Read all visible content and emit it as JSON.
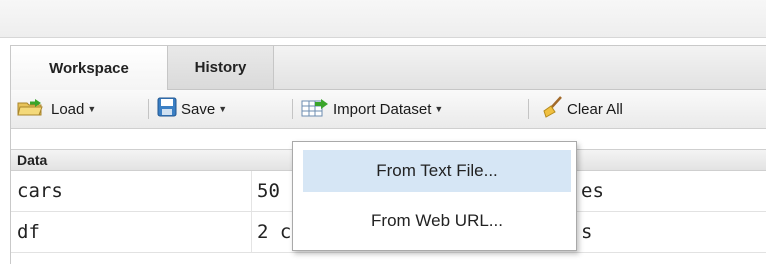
{
  "tabs": [
    {
      "label": "Workspace",
      "active": true
    },
    {
      "label": "History",
      "active": false
    }
  ],
  "toolbar": {
    "load_label": "Load",
    "save_label": "Save",
    "import_label": "Import Dataset",
    "clear_label": "Clear All"
  },
  "data_section": {
    "header": "Data"
  },
  "rows": [
    {
      "name": "cars",
      "value": "50",
      "type": "es"
    },
    {
      "name": "df",
      "value": "2 c",
      "type": "s"
    }
  ],
  "import_menu": {
    "items": [
      {
        "label": "From Text File...",
        "highlighted": true
      },
      {
        "label": "From Web URL...",
        "highlighted": false
      }
    ]
  },
  "colors": {
    "menu_highlight": "#d6e6f5",
    "accent_green": "#3aa52b"
  }
}
